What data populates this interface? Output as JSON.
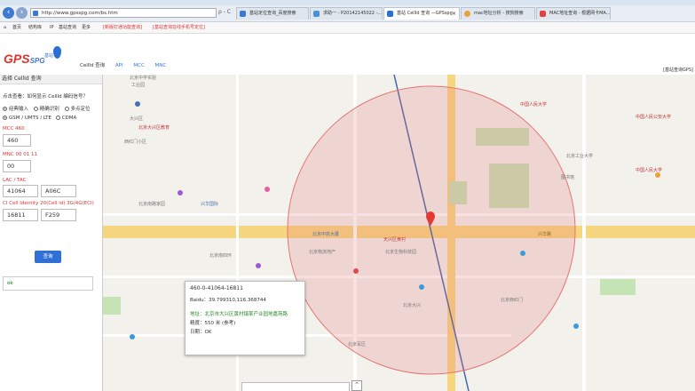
{
  "browser": {
    "url": "http://www.gpsspg.com/bs.htm",
    "url_controls": "ρ - C",
    "tabs": [
      {
        "title": "基站定位查询_百度搜索",
        "color": "#3a78d6",
        "active": false
      },
      {
        "title": "求助一 - P20142145022 -...",
        "color": "#4a90d9",
        "active": false
      },
      {
        "title": "基站 CellId 查询 —GPSspg",
        "color": "#2b6fd1",
        "active": true
      },
      {
        "title": "mac地址分析 - 搜狗搜索",
        "color": "#e8a33a",
        "active": false
      },
      {
        "title": "MAC地址查询 - 根据网卡MA...",
        "color": "#d44",
        "active": false
      }
    ],
    "favorites": [
      "首页",
      "结构库",
      "IP",
      "基站查询",
      "更多"
    ],
    "fav_links": [
      "[新版打通功能查询]",
      "[基站查询在线手机号定位]"
    ]
  },
  "header": {
    "logo": "GPS",
    "logo_suffix": "SPG",
    "logo_sub": "基站",
    "nav": [
      "CellId 查询",
      "API",
      "MCC",
      "MNC"
    ],
    "right_hint": "[基站查询GPS]"
  },
  "panel": {
    "title": "选择 CellId 查询",
    "question": "点击查看：如何显示 CellId 编码信号？",
    "modes": [
      "经典输入",
      "精确识别",
      "多点定位"
    ],
    "networks": [
      "GSM / UMTS / LTE",
      "CDMA"
    ],
    "mcc_label": "MCC 460",
    "mcc_value": "460",
    "mnc_label": "MNC 00 01 11",
    "mnc_value": "00",
    "lac_label": "LAC / TAC",
    "lac_dec": "41064",
    "lac_hex": "A06C",
    "ci_label": "CI Cell Identity 20(Cell id) 3G/4G(ECI)",
    "ci_dec": "16811",
    "ci_hex": "F259",
    "query_button": "查询",
    "result": "ok"
  },
  "map": {
    "accent": "#e57373",
    "popup": {
      "line1": "460-0-41064-16811",
      "line2": "Baidu：39.799310,116.368744",
      "line3": "地址：北京市大兴区黄村镇某产业园地嘉苑路",
      "line4": "精度：550 米 (参考)",
      "line5": "日期：OK"
    },
    "road_label": "兴华路",
    "pois": [
      {
        "t": "北京中学实验",
        "c": ""
      },
      {
        "t": "工业园",
        "c": ""
      },
      {
        "t": "大兴区",
        "c": ""
      },
      {
        "t": "北京大兴区教育",
        "c": "r"
      },
      {
        "t": "中国人民大学",
        "c": "r"
      },
      {
        "t": "西红门小区",
        "c": ""
      },
      {
        "t": "中国人民公安大学",
        "c": "r"
      },
      {
        "t": "图书馆",
        "c": ""
      },
      {
        "t": "北京工业大学",
        "c": ""
      },
      {
        "t": "北京南路家园",
        "c": ""
      },
      {
        "t": "兴华国际",
        "c": "b"
      },
      {
        "t": "北京物流地产",
        "c": ""
      },
      {
        "t": "北京中凯大厦",
        "c": "b"
      },
      {
        "t": "北京生物科技园",
        "c": ""
      },
      {
        "t": "北京南四环",
        "c": ""
      },
      {
        "t": "天兴区黄村",
        "c": "r"
      },
      {
        "t": "中国人民大学",
        "c": "r"
      },
      {
        "t": "北京大兴",
        "c": ""
      },
      {
        "t": "北京军区",
        "c": ""
      },
      {
        "t": "北京西红门",
        "c": ""
      }
    ]
  }
}
